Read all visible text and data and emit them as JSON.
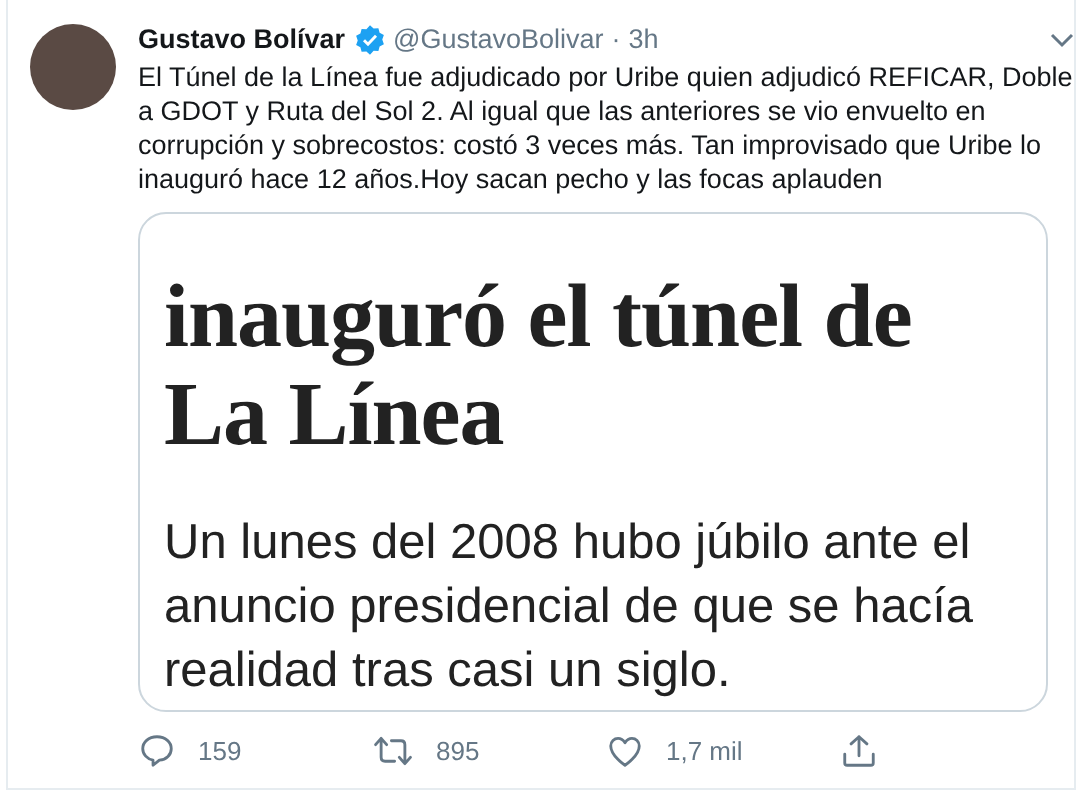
{
  "tweet": {
    "author": "Gustavo Bolívar",
    "verified": true,
    "handle": "@GustavoBolivar",
    "separator": "·",
    "time": "3h",
    "text": "El Túnel de la Línea fue adjudicado por Uribe quien adjudicó REFICAR, Doble a GDOT y Ruta del Sol 2. Al igual que las anteriores se vio envuelto en corrupción y sobrecostos: costó 3 veces más. Tan improvisado que Uribe lo inauguró hace 12 años.Hoy sacan pecho y las focas aplauden",
    "media": {
      "headline": "inauguró el túnel de La Línea",
      "body": "Un lunes del 2008 hubo júbilo ante el anuncio presidencial de que se hacía realidad tras casi un siglo."
    },
    "actions": [
      {
        "kind": "reply",
        "count": "159"
      },
      {
        "kind": "retweet",
        "count": "895"
      },
      {
        "kind": "like",
        "count": "1,7 mil"
      },
      {
        "kind": "share"
      }
    ]
  }
}
